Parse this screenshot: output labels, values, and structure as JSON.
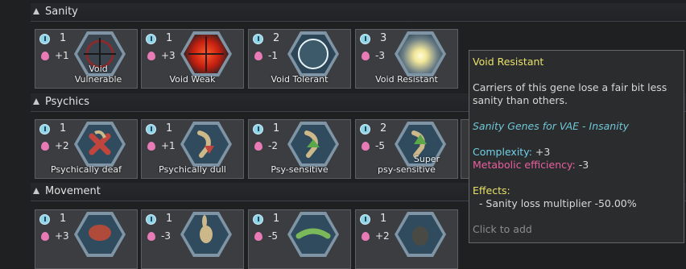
{
  "sections": [
    {
      "title": "Sanity"
    },
    {
      "title": "Psychics"
    },
    {
      "title": "Movement"
    }
  ],
  "genes": {
    "void_vulnerable": {
      "complexity": "1",
      "metabolic": "+1",
      "label_line1": "Void",
      "label_line2": "Vulnerable",
      "icon": "void-vulnerable-icon"
    },
    "void_weak": {
      "complexity": "1",
      "metabolic": "+3",
      "label": "Void Weak",
      "icon": "void-weak-icon"
    },
    "void_tolerant": {
      "complexity": "2",
      "metabolic": "-1",
      "label": "Void Tolerant",
      "icon": "void-tolerant-icon"
    },
    "void_resistant": {
      "complexity": "3",
      "metabolic": "-3",
      "label": "Void Resistant",
      "icon": "void-resistant-icon"
    },
    "psychically_deaf": {
      "complexity": "1",
      "metabolic": "+2",
      "label": "Psychically deaf",
      "icon": "psychically-deaf-icon"
    },
    "psychically_dull": {
      "complexity": "1",
      "metabolic": "+1",
      "label": "Psychically dull",
      "icon": "psychically-dull-icon"
    },
    "psy_sensitive": {
      "complexity": "1",
      "metabolic": "-2",
      "label": "Psy-sensitive",
      "icon": "psy-sensitive-icon"
    },
    "super_psy_sensitive": {
      "complexity": "2",
      "metabolic": "-5",
      "label_line1": "Super",
      "label_line2": "psy-sensitive",
      "icon": "super-psy-sensitive-icon"
    },
    "movement_1": {
      "complexity": "1",
      "metabolic": "+3",
      "icon": "turtle-icon"
    },
    "movement_2": {
      "complexity": "1",
      "metabolic": "-3",
      "icon": "rabbit-icon"
    },
    "movement_3": {
      "complexity": "1",
      "metabolic": "-5",
      "icon": "lizard-icon"
    },
    "movement_4": {
      "complexity": "1",
      "metabolic": "+2",
      "icon": "creature-icon"
    }
  },
  "tooltip": {
    "title": "Void Resistant",
    "description": "Carriers of this gene lose a fair bit less sanity than others.",
    "source": "Sanity Genes for VAE - Insanity",
    "complexity_label": "Complexity:",
    "complexity_value": " +3",
    "metabolic_label": "Metabolic efficiency:",
    "metabolic_value": " -3",
    "effects_label": "Effects:",
    "effect_1": "  - Sanity loss multiplier -50.00%",
    "hint": "Click to add"
  },
  "colors": {
    "complexity": "#6fd1e6",
    "metabolic": "#e8609f",
    "title": "#e8e26a"
  }
}
